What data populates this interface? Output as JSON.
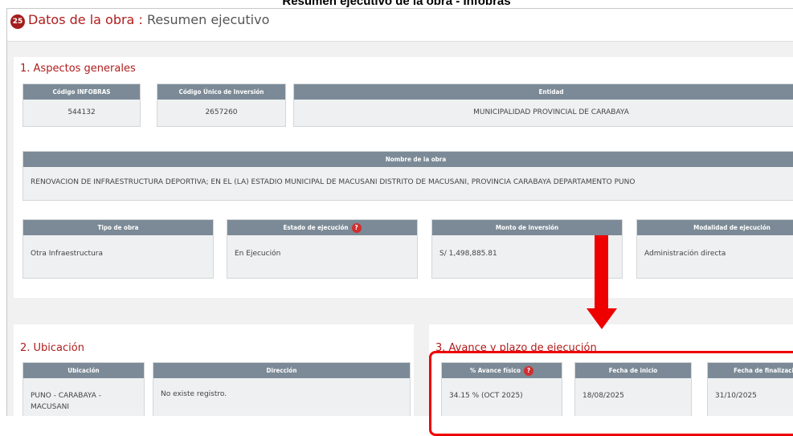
{
  "caption": "Resumen ejecutivo de la obra - Infobras",
  "header": {
    "icon_text": "25",
    "title": "Datos de la obra :",
    "subtitle": "Resumen ejecutivo"
  },
  "general": {
    "title": "1. Aspectos generales",
    "codigo_infobras": {
      "label": "Código INFOBRAS",
      "value": "544132"
    },
    "codigo_unico": {
      "label": "Código Único de Inversión",
      "value": "2657260"
    },
    "entidad": {
      "label": "Entidad",
      "value": "MUNICIPALIDAD PROVINCIAL DE CARABAYA"
    },
    "nombre": {
      "label": "Nombre de la obra",
      "value": "RENOVACION DE INFRAESTRUCTURA DEPORTIVA; EN EL (LA) ESTADIO MUNICIPAL DE MACUSANI DISTRITO DE MACUSANI, PROVINCIA CARABAYA DEPARTAMENTO PUNO"
    },
    "tipo": {
      "label": "Tipo de obra",
      "value": "Otra Infraestructura"
    },
    "estado": {
      "label": "Estado de ejecución",
      "help": "?",
      "value": "En Ejecución"
    },
    "monto": {
      "label": "Monto de inversión",
      "value": "S/ 1,498,885.81"
    },
    "modalidad": {
      "label": "Modalidad de ejecución",
      "value": "Administración directa"
    }
  },
  "ubicacion": {
    "title": "2. Ubicación",
    "ubic": {
      "label": "Ubicación",
      "value": "PUNO - CARABAYA - MACUSANI"
    },
    "direccion": {
      "label": "Dirección",
      "value": "No existe registro."
    }
  },
  "avance": {
    "title": "3. Avance y plazo de ejecución",
    "fisico": {
      "label": "% Avance físico",
      "help": "?",
      "value": "34.15 % (OCT 2025)"
    },
    "inicio": {
      "label": "Fecha de inicio",
      "value": "18/08/2025"
    },
    "fin": {
      "label": "Fecha de finalizació",
      "value": "31/10/2025"
    }
  },
  "annotation": {
    "color": "#ef0000"
  }
}
